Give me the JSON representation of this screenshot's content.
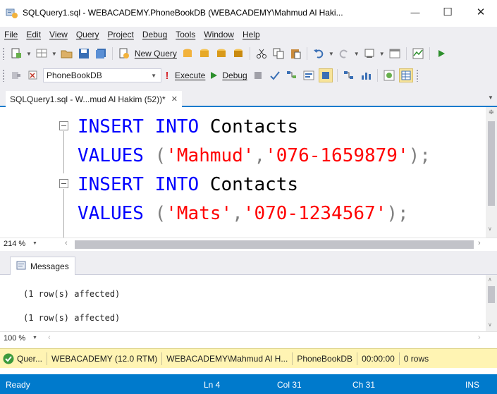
{
  "window": {
    "title": "SQLQuery1.sql - WEBACADEMY.PhoneBookDB (WEBACADEMY\\Mahmud Al Haki...",
    "minimize_glyph": "—",
    "maximize_glyph": "☐",
    "close_glyph": "✕"
  },
  "menu": [
    "File",
    "Edit",
    "View",
    "Query",
    "Project",
    "Debug",
    "Tools",
    "Window",
    "Help"
  ],
  "toolbar1": {
    "new_query_label": "New Query"
  },
  "toolbar2": {
    "database": "PhoneBookDB",
    "execute_label": "Execute",
    "debug_label": "Debug"
  },
  "document_tab": {
    "label": "SQLQuery1.sql - W...mud Al Hakim (52))*",
    "close_glyph": "✕"
  },
  "editor": {
    "line1": {
      "kw1": "INSERT",
      "kw2": "INTO",
      "table": "Contacts"
    },
    "line2": {
      "kw": "VALUES",
      "open": "(",
      "str1": "'Mahmud'",
      "comma": ",",
      "str2": "'076-1659879'",
      "close": ");"
    },
    "line3": {
      "kw1": "INSERT",
      "kw2": "INTO",
      "table": "Contacts"
    },
    "line4": {
      "kw": "VALUES",
      "open": "(",
      "str1": "'Mats'",
      "comma": ",",
      "str2": "'070-1234567'",
      "close": ");"
    },
    "zoom": "214 %"
  },
  "results": {
    "tab_label": "Messages",
    "messages": [
      "(1 row(s) affected)",
      "(1 row(s) affected)"
    ],
    "zoom": "100 %"
  },
  "query_status": {
    "status": "Quer...",
    "server": "WEBACADEMY (12.0 RTM)",
    "user": "WEBACADEMY\\Mahmud Al H...",
    "database": "PhoneBookDB",
    "elapsed": "00:00:00",
    "rows": "0 rows"
  },
  "statusbar": {
    "ready": "Ready",
    "line": "Ln 4",
    "col": "Col 31",
    "ch": "Ch 31",
    "mode": "INS"
  },
  "colors": {
    "accent": "#007acc",
    "keyword": "#0000ff",
    "string": "#ff0000",
    "query_status_bg": "#fff4b3"
  }
}
